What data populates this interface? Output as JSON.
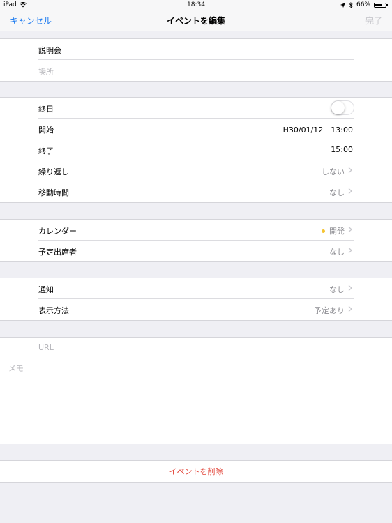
{
  "status": {
    "device": "iPad",
    "time": "18:34",
    "battery": "66%"
  },
  "nav": {
    "cancel": "キャンセル",
    "title": "イベントを編集",
    "done": "完了"
  },
  "basics": {
    "title": "説明会",
    "location_placeholder": "場所"
  },
  "timing": {
    "allday_label": "終日",
    "allday_on": false,
    "start_label": "開始",
    "start_value": "H30/01/12　13:00",
    "end_label": "終了",
    "end_value": "15:00",
    "repeat_label": "繰り返し",
    "repeat_value": "しない",
    "travel_label": "移動時間",
    "travel_value": "なし"
  },
  "calendar": {
    "calendar_label": "カレンダー",
    "calendar_value": "開発",
    "calendar_color": "#f5c433",
    "invitees_label": "予定出席者",
    "invitees_value": "なし"
  },
  "alerts": {
    "alert_label": "通知",
    "alert_value": "なし",
    "show_as_label": "表示方法",
    "show_as_value": "予定あり"
  },
  "notes": {
    "url_placeholder": "URL",
    "memo_placeholder": "メモ"
  },
  "delete_label": "イベントを削除"
}
